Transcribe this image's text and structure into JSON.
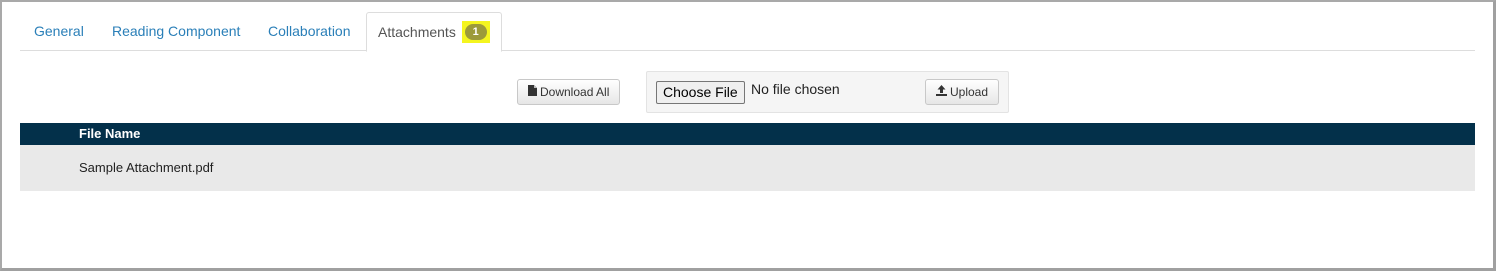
{
  "tabs": [
    {
      "label": "General",
      "active": false
    },
    {
      "label": "Reading Component",
      "active": false
    },
    {
      "label": "Collaboration",
      "active": false
    },
    {
      "label": "Attachments",
      "active": true,
      "badge": "1"
    }
  ],
  "toolbar": {
    "download_all_label": "Download All",
    "choose_file_label": "Choose File",
    "file_status": "No file chosen",
    "upload_label": "Upload"
  },
  "table": {
    "columns": [
      "File Name"
    ],
    "rows": [
      {
        "file_name": "Sample Attachment.pdf"
      }
    ]
  },
  "colors": {
    "tab_link": "#2a7fb8",
    "table_header_bg": "#03304a",
    "row_bg": "#e9e9e9",
    "badge_highlight": "#f4f51f",
    "badge_bg": "#9c9a3a"
  }
}
